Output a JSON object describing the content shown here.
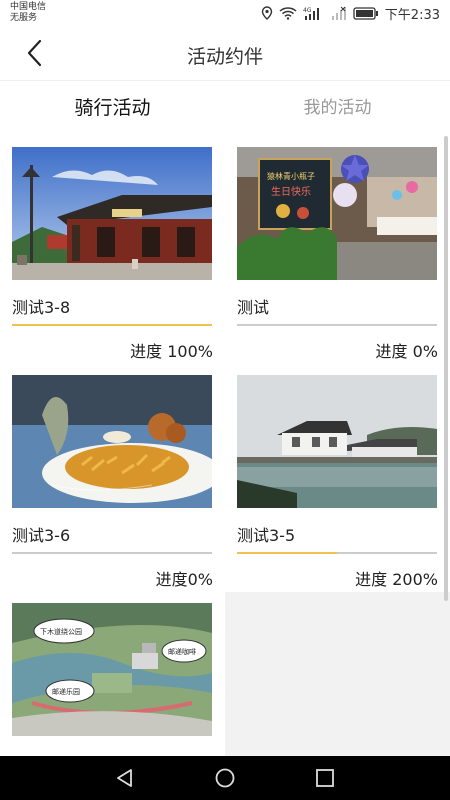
{
  "status": {
    "carrier1": "中国电信",
    "carrier2": "无服务",
    "time": "下午2:33"
  },
  "header": {
    "title": "活动约伴"
  },
  "tabs": [
    {
      "label": "骑行活动"
    },
    {
      "label": "我的活动"
    }
  ],
  "cards": [
    {
      "name": "测试3-8",
      "progress_text": "进度 100%",
      "progress": 1.0,
      "image": "ancient-temple-photo"
    },
    {
      "name": "测试",
      "progress_text": "进度 0%",
      "progress": 0.0,
      "image": "birthday-party-photo"
    },
    {
      "name": "测试3-6",
      "progress_text": "进度0%",
      "progress": 0.0,
      "image": "fries-snack-photo"
    },
    {
      "name": "测试3-5",
      "progress_text": "进度 200%",
      "progress": 0.5,
      "image": "lakeside-village-photo"
    },
    {
      "name": "",
      "progress_text": "",
      "progress": 0.0,
      "image": "park-map-photo"
    }
  ],
  "colors": {
    "accent": "#4cd964",
    "progress": "#f2c14e",
    "inactive": "#999999"
  },
  "map_labels": {
    "a": "下木道绕公园",
    "b": "邮递咖啡",
    "c": "邮递乐园"
  },
  "photo_text": {
    "a": "生日快乐",
    "b": "猿林青小瓶子"
  }
}
